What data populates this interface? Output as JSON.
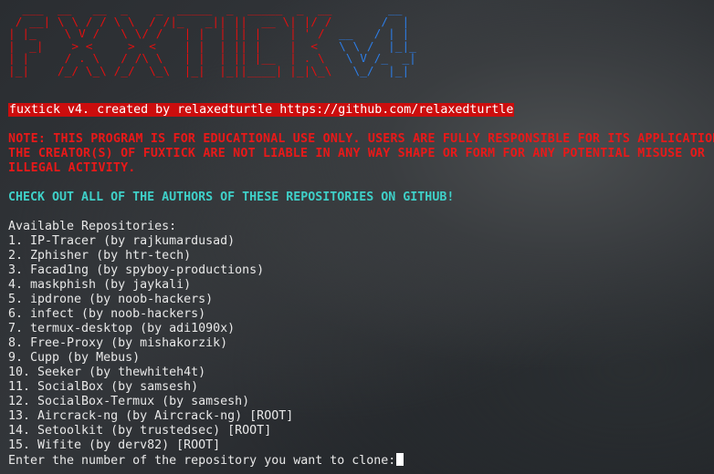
{
  "ascii_logo": {
    "red_lines": [
      "  ___  __   __  _    _  _____  _  _____  _  __ ",
      " / __| \\ \\ / / \\ \\  / /|_   _|| ||  __ \\| |/ / ",
      "| |_    \\ V /   \\ \\/ /   | |  | || |    | ' /  ",
      "|  _|    > <     >  <    | |  | || |    |  <   ",
      "| |     / . \\   / /\\ \\   | |  | || |__  | . \\  ",
      "|_|    /_/ \\_\\ /_/  \\_\\  |_|  |_||____| |_|\\_\\ "
    ],
    "blue_lines": [
      "       __  ",
      "      /  | ",
      "__   / | | ",
      "\\ \\ /  |_|_",
      " \\ V /_  _|",
      "  \\_/  |_| "
    ]
  },
  "banner": "fuxtick v4. created by relaxedturtle https://github.com/relaxedturtle",
  "note_lines": [
    "NOTE: THIS PROGRAM IS FOR EDUCATIONAL USE ONLY. USERS ARE FULLY RESPONSIBLE FOR ITS APPLICATION.",
    "THE CREATOR(S) OF FUXTICK ARE NOT LIABLE IN ANY WAY SHAPE OR FORM FOR ANY POTENTIAL MISUSE OR",
    "ILLEGAL ACTIVITY."
  ],
  "check_out": "CHECK OUT ALL OF THE AUTHORS OF THESE REPOSITORIES ON GITHUB!",
  "list_heading": "Available Repositories:",
  "repositories": [
    "1. IP-Tracer (by rajkumardusad)",
    "2. Zphisher (by htr-tech)",
    "3. Facad1ng (by spyboy-productions)",
    "4. maskphish (by jaykali)",
    "5. ipdrone (by noob-hackers)",
    "6. infect (by noob-hackers)",
    "7. termux-desktop (by adi1090x)",
    "8. Free-Proxy (by mishakorzik)",
    "9. Cupp (by Mebus)",
    "10. Seeker (by thewhiteh4t)",
    "11. SocialBox (by samsesh)",
    "12. SocialBox-Termux (by samsesh)",
    "13. Aircrack-ng (by Aircrack-ng) [ROOT]",
    "14. Setoolkit (by trustedsec) [ROOT]",
    "15. Wifite (by derv82) [ROOT]"
  ],
  "prompt": "Enter the number of the repository you want to clone:",
  "colors": {
    "banner_bg": "#cc0d0d",
    "warning": "#e81919",
    "highlight": "#3fd0c8",
    "logo_red": "#e01010",
    "logo_blue": "#2d7de6"
  }
}
